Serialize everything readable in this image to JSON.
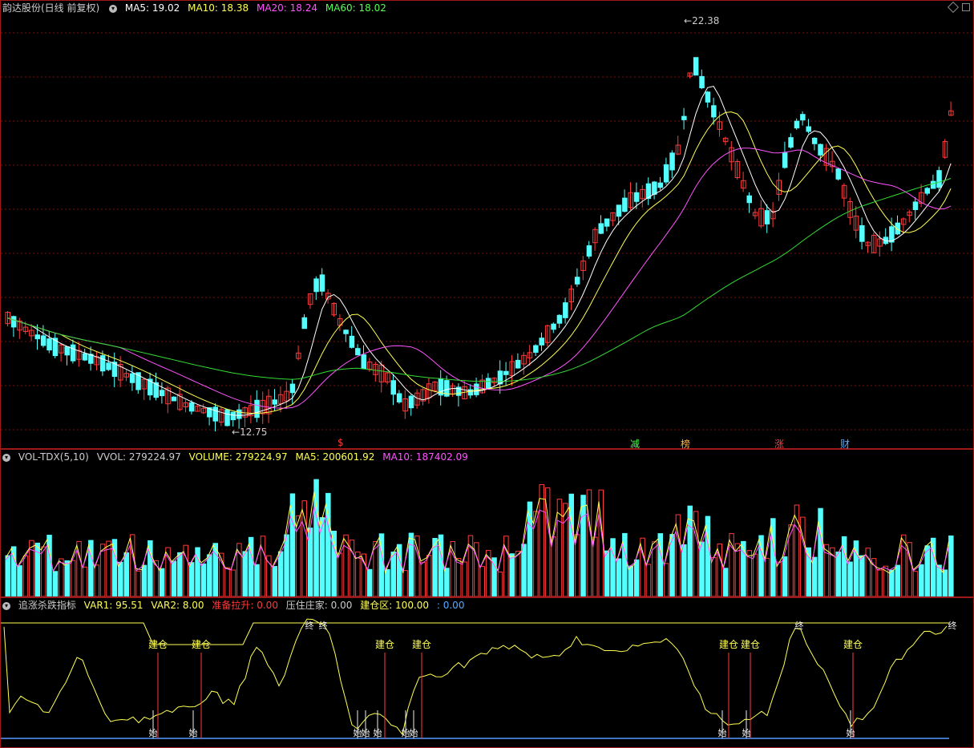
{
  "main": {
    "title": "韵达股份(日线 前复权)",
    "ma5_label": "MA5: 19.02",
    "ma10_label": "MA10: 18.38",
    "ma20_label": "MA20: 18.24",
    "ma60_label": "MA60: 18.02",
    "high_label": "22.38",
    "low_label": "12.75",
    "event_marks": [
      "$",
      "减",
      "榜",
      "涨",
      "财"
    ]
  },
  "volume": {
    "title": "VOL-TDX(5,10)",
    "vvol_label": "VVOL: 279224.97",
    "volume_label": "VOLUME: 279224.97",
    "ma5_label": "MA5: 200601.92",
    "ma10_label": "MA10: 187402.09"
  },
  "indicator": {
    "title": "追涨杀跌指标",
    "var1_label": "VAR1: 95.51",
    "var2_label": "VAR2: 8.00",
    "prep_label": "准备拉升: 0.00",
    "zhuangjia_label": "压住庄家: 0.00",
    "jiancang_label": "建仓区: 100.00",
    "extra_label": ": 0.00",
    "jiancang_text": "建仓",
    "end_text": "终",
    "start_text": "始"
  },
  "colors": {
    "up": "#ff3b3b",
    "down": "#54ffff",
    "ma5": "#ffffff",
    "ma10": "#ffff54",
    "ma20": "#ff54ff",
    "ma60": "#33dd33",
    "grid": "#7a1010",
    "border": "#a01818",
    "text_gray": "#cccccc",
    "text_yellow": "#ffff54",
    "text_magenta": "#ff54ff",
    "text_green": "#54ff54",
    "text_red": "#ff3b3b",
    "text_cyan": "#54ffff"
  }
}
